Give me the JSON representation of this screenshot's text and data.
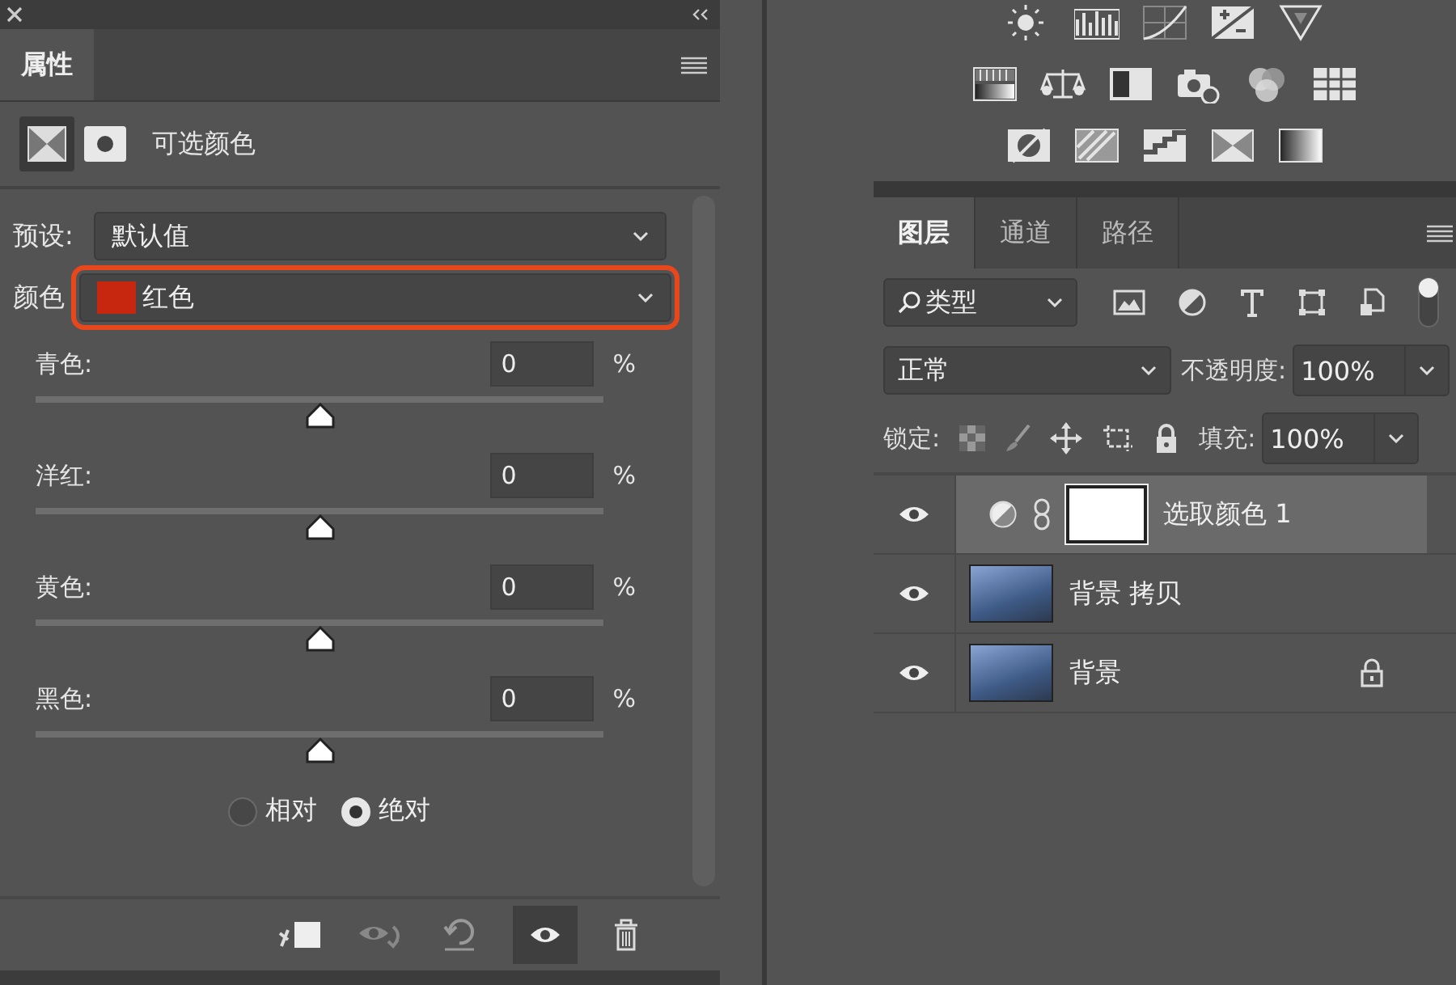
{
  "properties": {
    "title": "属性",
    "adjustment_name": "可选颜色",
    "preset": {
      "label": "预设:",
      "value": "默认值"
    },
    "colors": {
      "label": "颜色",
      "value": "红色",
      "color": "#c8270f",
      "highlighted": true
    },
    "sliders": [
      {
        "label": "青色:",
        "value": "0",
        "unit": "%",
        "level": 0.5
      },
      {
        "label": "洋红:",
        "value": "0",
        "unit": "%",
        "level": 0.5
      },
      {
        "label": "黄色:",
        "value": "0",
        "unit": "%",
        "level": 0.5
      },
      {
        "label": "黑色:",
        "value": "0",
        "unit": "%",
        "level": 0.5
      }
    ],
    "method": [
      {
        "label": "相对",
        "selected": false
      },
      {
        "label": "绝对",
        "selected": true
      }
    ]
  },
  "layers_panel": {
    "tabs": [
      {
        "label": "图层",
        "selected": true
      },
      {
        "label": "通道",
        "selected": false
      },
      {
        "label": "路径",
        "selected": false
      }
    ],
    "filter": {
      "value": "类型",
      "on": true
    },
    "blend_mode": "正常",
    "opacity": {
      "label": "不透明度:",
      "value": "100%"
    },
    "lock_label": "锁定:",
    "fill": {
      "label": "填充:",
      "value": "100%"
    },
    "layers": [
      {
        "kind": "adjustment",
        "name": "选取颜色 1",
        "visible": true,
        "selected": true,
        "locked": false
      },
      {
        "kind": "image",
        "name": "背景 拷贝",
        "visible": true,
        "selected": false,
        "locked": false
      },
      {
        "kind": "image",
        "name": "背景",
        "visible": true,
        "selected": false,
        "locked": true
      }
    ]
  }
}
